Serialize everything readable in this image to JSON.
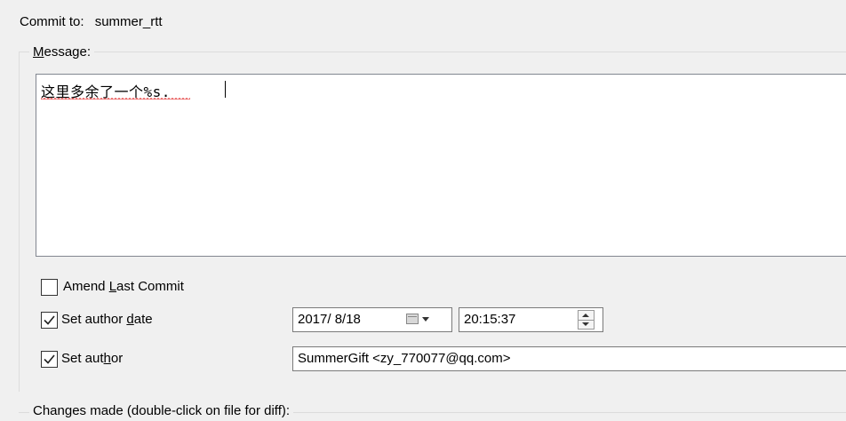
{
  "commit": {
    "label": "Commit to:",
    "branch": "summer_rtt"
  },
  "message": {
    "legend_mnemonic": "M",
    "legend_rest": "essage:",
    "text": "这里多余了一个%s."
  },
  "options": {
    "amend": {
      "mnemonic_before": "Amend ",
      "mnemonic": "L",
      "after": "ast Commit",
      "checked": false
    },
    "author_date": {
      "before": "Set author ",
      "mnemonic": "d",
      "after": "ate",
      "checked": true
    },
    "author": {
      "before": "Set aut",
      "mnemonic": "h",
      "after": "or",
      "checked": true
    }
  },
  "date_value": "2017/ 8/18",
  "time_value": "20:15:37",
  "author_value": "SummerGift <zy_770077@qq.com>",
  "changes_legend": "Changes made (double-click on file for diff):",
  "icons": {
    "calendar": "calendar-icon",
    "dropdown": "chevron-down-icon",
    "spin": "spin-updown-icon"
  }
}
